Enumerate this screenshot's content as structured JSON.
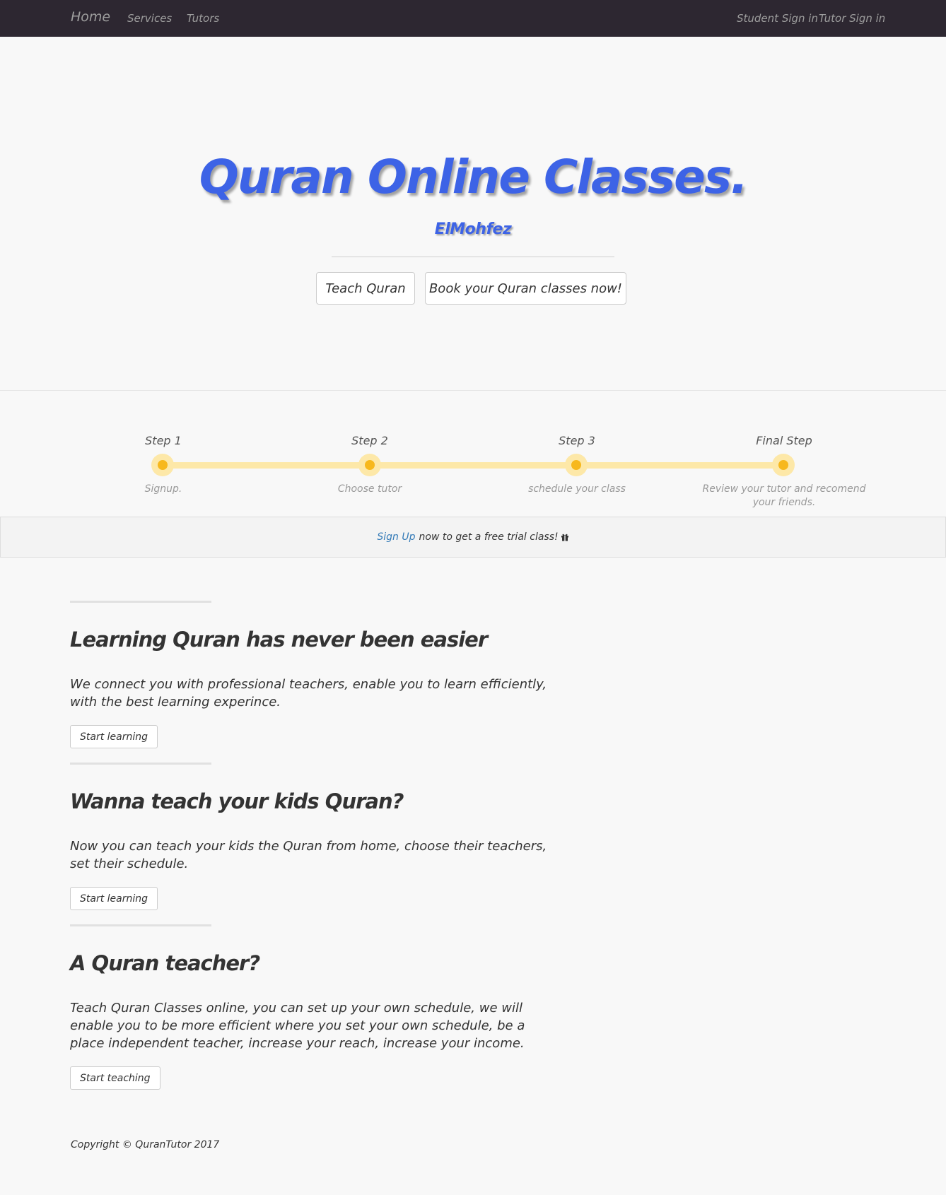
{
  "nav": {
    "brand": "Home",
    "services": "Services",
    "tutors": "Tutors",
    "student_sign_in": "Student Sign in",
    "tutor_sign_in": "Tutor Sign in"
  },
  "hero": {
    "title": "Quran Online Classes.",
    "subtitle": "ElMohfez",
    "teach_button": "Teach Quran",
    "book_button": "Book your Quran classes now!"
  },
  "steps": [
    {
      "title": "Step 1",
      "description": "Signup."
    },
    {
      "title": "Step 2",
      "description": "Choose tutor"
    },
    {
      "title": "Step 3",
      "description": "schedule your class"
    },
    {
      "title": "Final Step",
      "description": "Review your tutor and recomend your friends."
    }
  ],
  "trial": {
    "link": "Sign Up",
    "text": "now to get a free trial class!",
    "icon": "gift-icon"
  },
  "sections": [
    {
      "title": "Learning Quran has never been easier",
      "text": "We connect you with professional teachers, enable you to learn efficiently, with the best learning experince.",
      "button": "Start learning"
    },
    {
      "title": "Wanna teach your kids Quran?",
      "text": "Now you can teach your kids the Quran from home, choose their teachers, set their schedule.",
      "button": "Start learning"
    },
    {
      "title": "A Quran teacher?",
      "text": "Teach Quran Classes online, you can set up your own schedule, we will enable you to be more efficient where you set your own schedule, be a place independent teacher, increase your reach, increase your income.",
      "button": "Start teaching"
    }
  ],
  "footer": {
    "copyright": "Copyright © QuranTutor 2017"
  },
  "colors": {
    "navbar": "#2d2731",
    "hero_title": "#3d63e6",
    "step_track": "#fde8a8",
    "step_dot": "#f7b81d",
    "link": "#337ab7"
  }
}
